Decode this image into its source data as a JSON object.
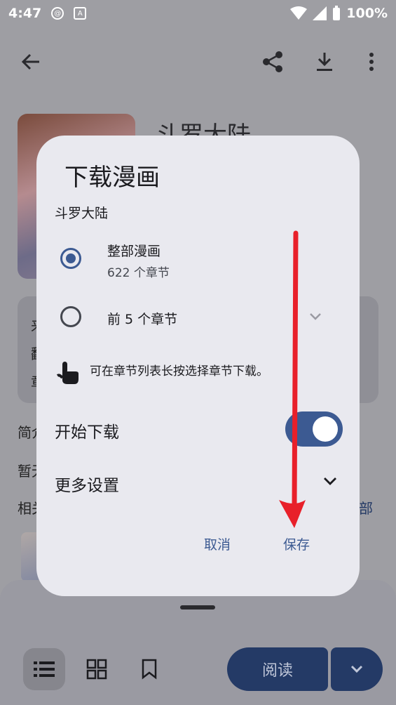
{
  "status_bar": {
    "time": "4:47",
    "battery": "100%",
    "icons": [
      "notification-icon",
      "app-icon",
      "wifi-icon",
      "signal-icon",
      "battery-icon"
    ]
  },
  "toolbar": {
    "icons": [
      "back-arrow-icon",
      "share-icon",
      "download-icon",
      "more-vert-icon"
    ]
  },
  "background": {
    "manga_title": "斗罗大陆",
    "card_lines": [
      "来",
      "翻",
      "章"
    ],
    "intro_partial": "简介",
    "status_partial": "暂无",
    "related_partial": "相关",
    "all_partial": "部"
  },
  "dialog": {
    "title": "下载漫画",
    "manga_name": "斗罗大陆",
    "options": [
      {
        "label": "整部漫画",
        "sub": "622 个章节",
        "selected": true
      },
      {
        "label": "前 5 个章节",
        "selected": false
      }
    ],
    "hint": "可在章节列表长按选择章节下载。",
    "start_download_label": "开始下载",
    "start_download_on": true,
    "more_settings_label": "更多设置",
    "cancel_label": "取消",
    "save_label": "保存"
  },
  "bottom_bar": {
    "read_label": "阅读",
    "icons": [
      "list-icon",
      "grid-icon",
      "bookmark-icon",
      "chevron-down-icon"
    ]
  },
  "colors": {
    "accent": "#3c5a92",
    "dialog_bg": "#e9e9ef",
    "scrim_bg": "#9e9ea3",
    "annotation_arrow": "#e8202a"
  }
}
